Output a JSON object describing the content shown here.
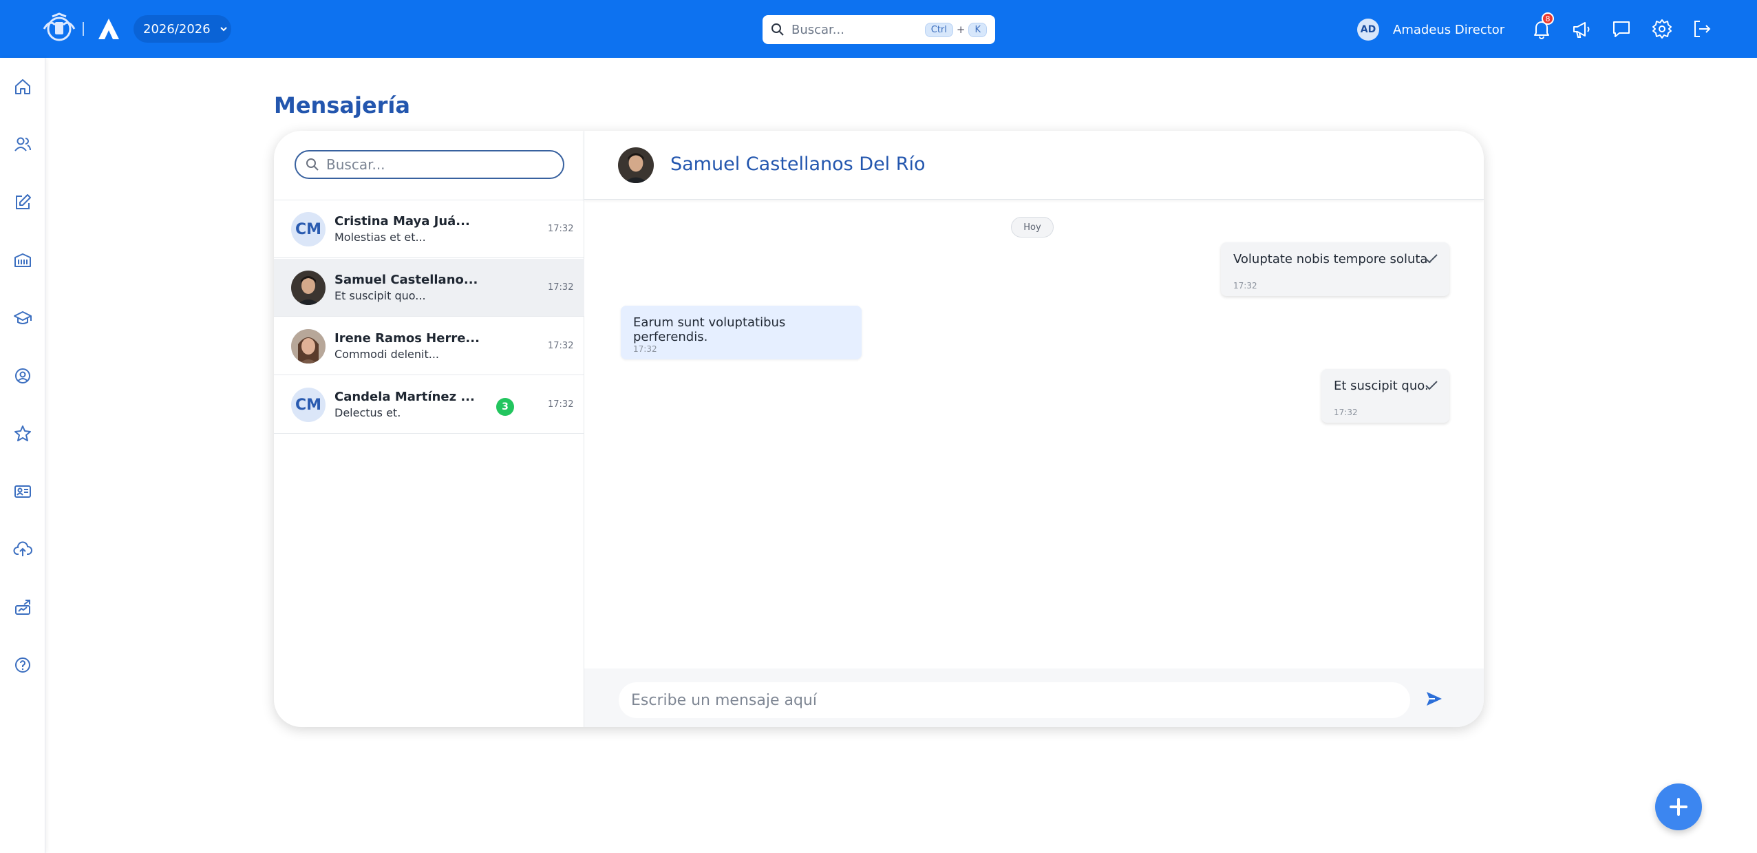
{
  "header": {
    "year": "2026/2026",
    "search_placeholder": "Buscar...",
    "shortcut_ctrl": "Ctrl",
    "shortcut_plus": "+",
    "shortcut_key": "K",
    "user_initials": "AD",
    "user_name": "Amadeus Director",
    "notifications_count": "8"
  },
  "page": {
    "title": "Mensajería"
  },
  "conversations_panel": {
    "search_placeholder": "Buscar...",
    "items": [
      {
        "initials": "CM",
        "name": "Cristina Maya Juá...",
        "preview": "Molestias et et...",
        "time": "17:32",
        "unread": ""
      },
      {
        "initials": "",
        "name": "Samuel Castellano...",
        "preview": "Et suscipit quo...",
        "time": "17:32",
        "unread": ""
      },
      {
        "initials": "",
        "name": "Irene Ramos Herre...",
        "preview": "Commodi delenit...",
        "time": "17:32",
        "unread": ""
      },
      {
        "initials": "CM",
        "name": "Candela Martínez ...",
        "preview": "Delectus et.",
        "time": "17:32",
        "unread": "3"
      }
    ]
  },
  "chat": {
    "contact_name": "Samuel Castellanos Del Río",
    "date_chip": "Hoy",
    "messages": [
      {
        "direction": "out",
        "text": "Voluptate nobis tempore soluta.",
        "time": "17:32"
      },
      {
        "direction": "in",
        "text": "Earum sunt voluptatibus perferendis.",
        "time": "17:32"
      },
      {
        "direction": "out",
        "text": "Et suscipit quo.",
        "time": "17:32"
      }
    ],
    "composer_placeholder": "Escribe un mensaje aquí"
  },
  "colors": {
    "primary": "#0d72f0",
    "accent": "#2356ae",
    "unread_badge": "#22c55e",
    "notif_badge": "#e8382f"
  },
  "icons": {
    "sidebar": [
      "home-icon",
      "users-icon",
      "edit-icon",
      "school-icon",
      "graduation-cap-icon",
      "user-circle-icon",
      "star-icon",
      "id-card-icon",
      "cloud-upload-icon",
      "analytics-icon",
      "help-icon"
    ],
    "topbar": [
      "bell-icon",
      "megaphone-icon",
      "message-icon",
      "gear-icon",
      "logout-icon"
    ]
  }
}
